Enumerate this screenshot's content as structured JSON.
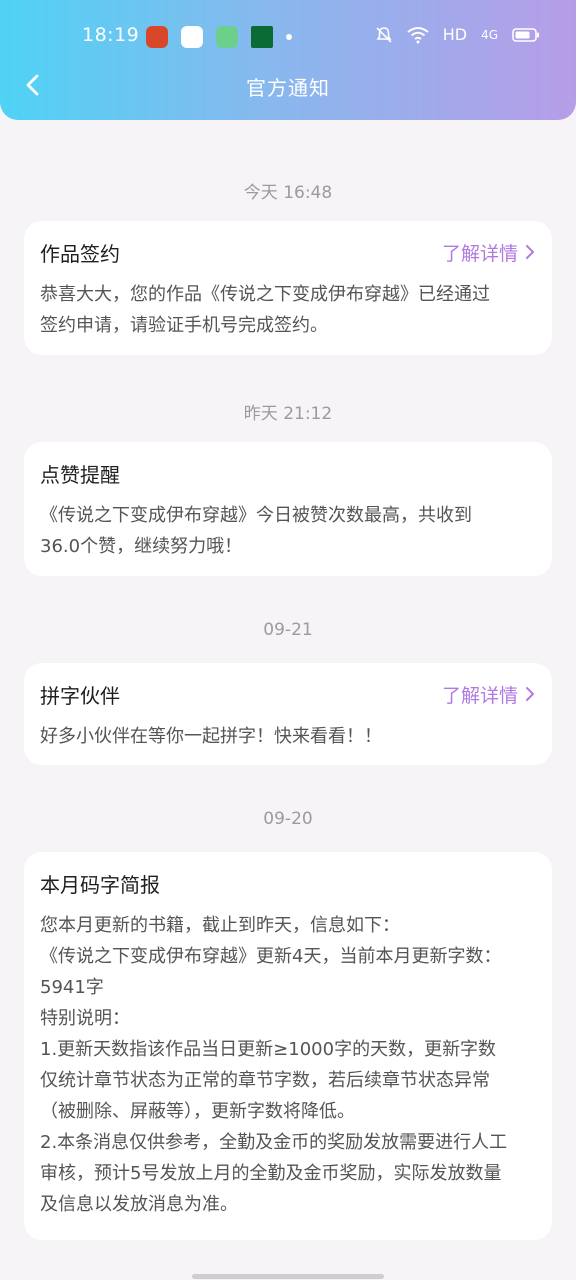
{
  "status_bar": {
    "time": "18:19",
    "network": "HD",
    "signal_type": "4G"
  },
  "nav": {
    "title": "官方通知"
  },
  "colors": {
    "header_gradient": [
      "#4fd3f5",
      "#86b9ee",
      "#b79de8"
    ],
    "link": "#b07ae2",
    "background": "#f6f4f7"
  },
  "messages": [
    {
      "date": "今天 16:48",
      "title": "作品签约",
      "link": "了解详情",
      "body": [
        "恭喜大大，您的作品《传说之下变成伊布穿越》已经通过",
        "签约申请，请验证手机号完成签约。"
      ]
    },
    {
      "date": "昨天 21:12",
      "title": "点赞提醒",
      "body": [
        "《传说之下变成伊布穿越》今日被赞次数最高，共收到",
        "36.0个赞，继续努力哦！"
      ]
    },
    {
      "date": "09-21",
      "title": "拼字伙伴",
      "link": "了解详情",
      "body": [
        "好多小伙伴在等你一起拼字！快来看看！！"
      ]
    },
    {
      "date": "09-20",
      "title": "本月码字简报",
      "body": [
        "您本月更新的书籍，截止到昨天，信息如下：",
        "《传说之下变成伊布穿越》更新4天，当前本月更新字数：",
        "5941字",
        "特别说明：",
        "1.更新天数指该作品当日更新≥1000字的天数，更新字数",
        "仅统计章节状态为正常的章节字数，若后续章节状态异常",
        "（被删除、屏蔽等），更新字数将降低。",
        "2.本条消息仅供参考，全勤及金币的奖励发放需要进行人工",
        "审核，预计5号发放上月的全勤及金币奖励，实际发放数量",
        "及信息以发放消息为准。"
      ]
    }
  ]
}
